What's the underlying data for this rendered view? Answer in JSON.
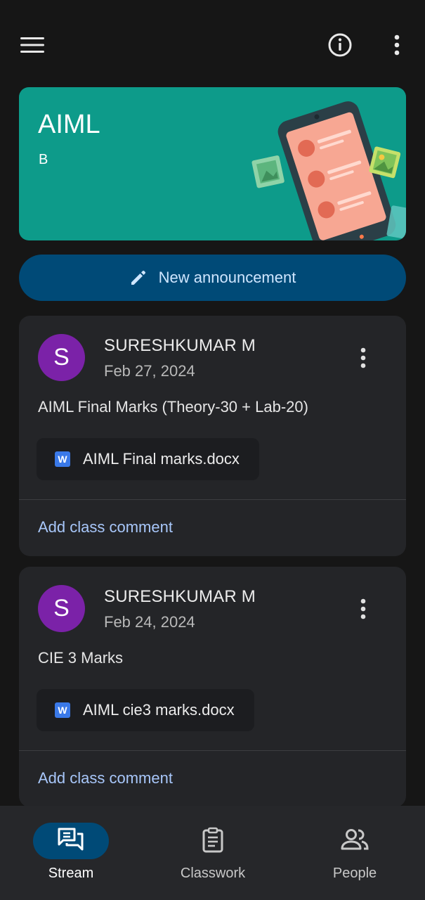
{
  "header": {
    "menu_icon": "hamburger-menu-icon",
    "info_icon": "info-circle-icon",
    "more_icon": "more-vertical-icon"
  },
  "banner": {
    "title": "AIML",
    "subtitle": "B",
    "color": "#0d9b8a"
  },
  "announce": {
    "label": "New announcement",
    "icon": "pencil-icon",
    "color": "#004a77"
  },
  "posts": [
    {
      "avatar_letter": "S",
      "author": "SURESHKUMAR M",
      "date": "Feb 27, 2024",
      "text": "AIML Final Marks (Theory-30 + Lab-20)",
      "attachment": "AIML Final marks.docx",
      "attachment_badge": "W",
      "comment_label": "Add class comment"
    },
    {
      "avatar_letter": "S",
      "author": "SURESHKUMAR M",
      "date": "Feb 24, 2024",
      "text": "CIE 3 Marks",
      "attachment": "AIML cie3 marks.docx",
      "attachment_badge": "W",
      "comment_label": "Add class comment"
    }
  ],
  "nav": {
    "items": [
      {
        "label": "Stream",
        "icon": "stream-icon",
        "selected": true
      },
      {
        "label": "Classwork",
        "icon": "classwork-icon",
        "selected": false
      },
      {
        "label": "People",
        "icon": "people-icon",
        "selected": false
      }
    ]
  },
  "colors": {
    "avatar": "#7b22a8",
    "link": "#a8c7fa",
    "word": "#3a79e8"
  }
}
